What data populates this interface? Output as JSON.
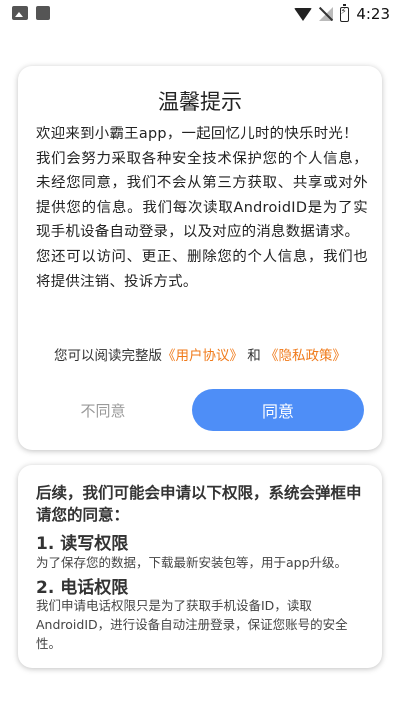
{
  "status_bar": {
    "time": "4:23",
    "icons": [
      "image-icon",
      "square-icon",
      "wifi-icon",
      "no-signal-icon",
      "battery-charging-icon"
    ]
  },
  "dialog": {
    "title": "温馨提示",
    "paragraphs": [
      "欢迎来到小霸王app，一起回忆儿时的快乐时光！",
      "我们会努力采取各种安全技术保护您的个人信息，未经您同意，我们不会从第三方获取、共享或对外提供您的信息。我们每次读取AndroidID是为了实现手机设备自动登录，以及对应的消息数据请求。",
      "您还可以访问、更正、删除您的个人信息，我们也将提供注销、投诉方式。"
    ],
    "agree_prefix": "您可以阅读完整版",
    "user_agreement_link": "《用户协议》",
    "agree_and": " 和 ",
    "privacy_policy_link": "《隐私政策》",
    "decline_button": "不同意",
    "accept_button": "同意",
    "accent_color": "#4e8ef7",
    "link_color": "#f07a1a"
  },
  "permissions": {
    "intro": "后续，我们可能会申请以下权限，系统会弹框申请您的同意：",
    "items": [
      {
        "title": "1. 读写权限",
        "description": "为了保存您的数据，下载最新安装包等，用于app升级。"
      },
      {
        "title": "2. 电话权限",
        "description": "我们申请电话权限只是为了获取手机设备ID，读取AndroidID，进行设备自动注册登录，保证您账号的安全性。"
      }
    ]
  }
}
